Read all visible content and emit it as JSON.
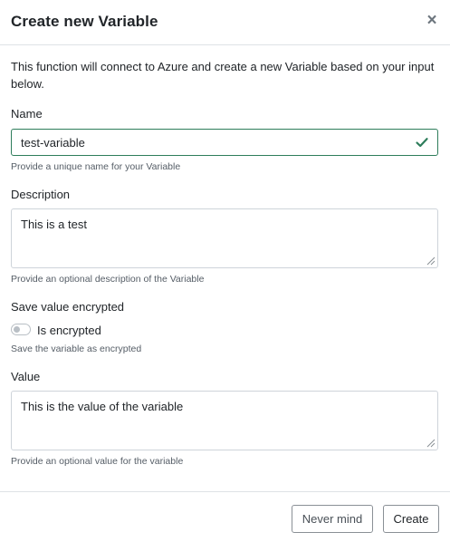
{
  "modal": {
    "title": "Create new Variable",
    "close_glyph": "×",
    "intro": "This function will connect to Azure and create a new Variable based on your input below."
  },
  "fields": {
    "name": {
      "label": "Name",
      "value": "test-variable",
      "help": "Provide a unique name for your Variable",
      "status_icon": "check-icon"
    },
    "description": {
      "label": "Description",
      "value": "This is a test",
      "help": "Provide an optional description of the Variable"
    },
    "encrypted": {
      "label": "Save value encrypted",
      "toggle_label": "Is encrypted",
      "checked": false,
      "help": "Save the variable as encrypted"
    },
    "value": {
      "label": "Value",
      "value": "This is the value of the variable",
      "help": "Provide an optional value for the variable"
    }
  },
  "footer": {
    "cancel_label": "Never mind",
    "create_label": "Create"
  },
  "colors": {
    "valid_border": "#2e7d5b",
    "check": "#2e7d5b",
    "text": "#212529",
    "muted": "#555d66"
  }
}
